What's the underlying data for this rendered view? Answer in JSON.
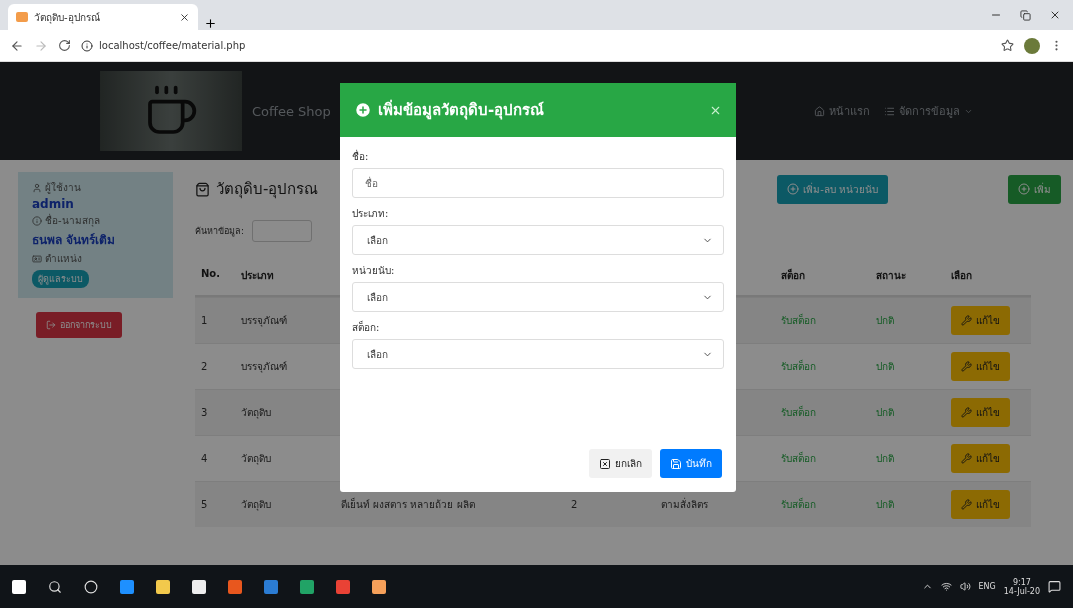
{
  "browser": {
    "tab_title": "วัตถุดิบ-อุปกรณ์",
    "url": "localhost/coffee/material.php"
  },
  "navbar": {
    "brand": "Coffee Shop",
    "links": [
      {
        "label": "หน้าแรก",
        "kind": "link"
      },
      {
        "label": "จัดการข้อมูล",
        "kind": "dropdown"
      }
    ]
  },
  "sidebar": {
    "user_label": "ผู้ใช้งาน",
    "username": "admin",
    "name_label": "ชื่อ-นามสกุล",
    "full_name": "ธนพล จันทร์เติม",
    "role_label": "ตำแหน่ง",
    "role": "ผู้ดูแลระบบ",
    "logout": "ออกจากระบบ"
  },
  "page": {
    "title": "วัตถุดิบ-อุปกรณ",
    "search_label": "ค้นหาข้อมูล:",
    "buttons": [
      {
        "label": "เพิ่ม-ลบ หน่วยนับ",
        "kind": "info"
      },
      {
        "label": "เพิ่ม",
        "kind": "success"
      }
    ]
  },
  "table": {
    "columns": [
      "No.",
      "ประเภท",
      "สต็อก",
      "สถานะ",
      "เลือก"
    ],
    "rows": [
      {
        "no": "1",
        "type": "บรรจุภัณฑ์",
        "stock": "รับสต็อก",
        "status": "ปกติ",
        "action": "แก้ไข"
      },
      {
        "no": "2",
        "type": "บรรจุภัณฑ์",
        "stock": "รับสต็อก",
        "status": "ปกติ",
        "action": "แก้ไข"
      },
      {
        "no": "3",
        "type": "วัตถุดิบ",
        "stock": "รับสต็อก",
        "status": "ปกติ",
        "action": "แก้ไข"
      },
      {
        "no": "4",
        "type": "วัตถุดิบ",
        "stock": "รับสต็อก",
        "status": "ปกติ",
        "action": "แก้ไข"
      },
      {
        "no": "5",
        "type": "วัตถุดิบ",
        "name": "ดีเย็นท์ ผงสตาร หลายถ้วย ผลิต",
        "quantity": "2",
        "unit": "ตามสั่งลิตร",
        "stock": "รับสต็อก",
        "status": "ปกติ",
        "action": "แก้ไข"
      }
    ]
  },
  "modal": {
    "title": "เพิ่มข้อมูลวัตถุดิบ-อุปกรณ์",
    "fields": [
      {
        "label": "ชื่อ:",
        "kind": "text",
        "placeholder": "ชื่อ"
      },
      {
        "label": "ประเภท:",
        "kind": "select",
        "value": "เลือก"
      },
      {
        "label": "หน่วยนับ:",
        "kind": "select",
        "value": "เลือก"
      },
      {
        "label": "สต็อก:",
        "kind": "select",
        "value": "เลือก"
      }
    ],
    "buttons": [
      {
        "label": "ยกเลิก",
        "kind": "secondary"
      },
      {
        "label": "บันทึก",
        "kind": "primary"
      }
    ]
  },
  "taskbar": {
    "language": "ENG",
    "time": "9:17",
    "date": "14-Jul-20"
  }
}
